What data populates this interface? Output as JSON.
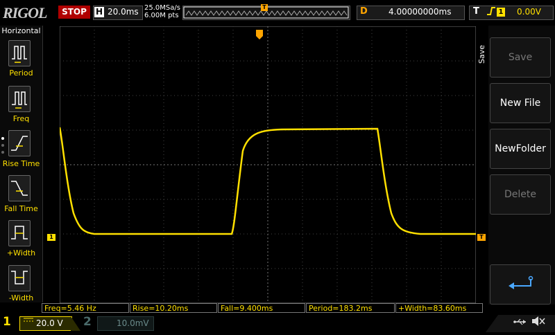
{
  "header": {
    "brand": "RIGOL",
    "run_state": "STOP",
    "horizontal_letter": "H",
    "timebase": "20.0ms",
    "sample_rate": "25.0MSa/s",
    "memory_depth": "6.00M pts",
    "trigger_marker": "T",
    "delay_letter": "D",
    "delay_value": "4.00000000ms",
    "trigger_letter": "T",
    "trigger_edge_icon": "rising-edge-icon",
    "trigger_channel": "1",
    "trigger_level": "0.00V"
  },
  "left_menu": {
    "title": "Horizontal",
    "items": [
      {
        "label": "Period",
        "icon": "period-icon"
      },
      {
        "label": "Freq",
        "icon": "frequency-icon"
      },
      {
        "label": "Rise Time",
        "icon": "rise-time-icon"
      },
      {
        "label": "Fall Time",
        "icon": "fall-time-icon"
      },
      {
        "label": "+Width",
        "icon": "positive-width-icon"
      },
      {
        "label": "-Width",
        "icon": "negative-width-icon"
      }
    ]
  },
  "right_menu": {
    "title": "Save",
    "buttons": [
      {
        "label": "Save",
        "enabled": false
      },
      {
        "label": "New File",
        "enabled": true
      },
      {
        "label": "NewFolder",
        "enabled": true
      },
      {
        "label": "Delete",
        "enabled": false
      },
      {
        "label": "",
        "icon": "return-arrow-icon",
        "enabled": true
      }
    ]
  },
  "waveform": {
    "channel_marker": "1",
    "trigger_level_marker": "T",
    "trace_color": "#ffe000"
  },
  "measurements": [
    {
      "text": "Freq=5.46 Hz"
    },
    {
      "text": "Rise=10.20ms"
    },
    {
      "text": "Fall=9.400ms"
    },
    {
      "text": "Period=183.2ms"
    },
    {
      "text": "+Width=83.60ms"
    }
  ],
  "footer": {
    "ch1_number": "1",
    "ch1_coupling_icon": "dc-coupling-icon",
    "ch1_scale": "20.0 V",
    "ch2_number": "2",
    "ch2_scale": "10.0mV",
    "usb_icon": "usb-icon",
    "mute_icon": "speaker-muted-icon"
  },
  "colors": {
    "ch1": "#ffe000",
    "trigger": "#ffa500",
    "stop": "#b00000"
  }
}
